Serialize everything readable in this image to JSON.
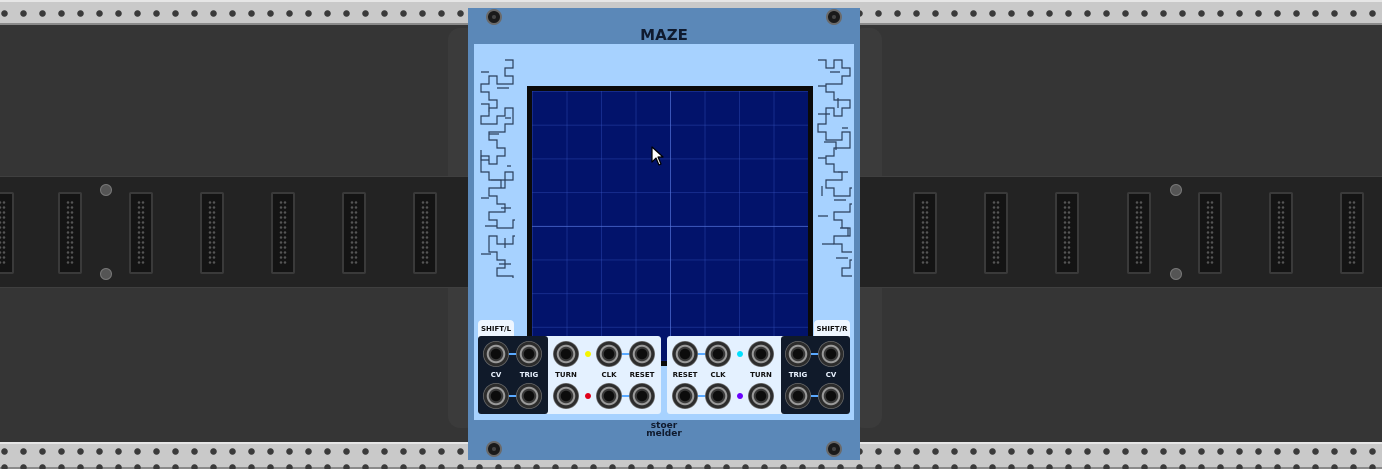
{
  "module": {
    "title": "MAZE",
    "brand_line1": "stoer",
    "brand_line2": "melder"
  },
  "shift": {
    "left_label": "SHIFT/L",
    "right_label": "SHIFT/R"
  },
  "left_panel": {
    "cv_label": "CV",
    "trig_label": "TRIG",
    "turn_label": "TURN",
    "clk_label": "CLK",
    "reset_label": "RESET",
    "led_top_color": "#f5f500",
    "led_bottom_color": "#e0001a"
  },
  "right_panel": {
    "reset_label": "RESET",
    "clk_label": "CLK",
    "turn_label": "TURN",
    "trig_label": "TRIG",
    "cv_label": "CV",
    "led_top_color": "#00e0ff",
    "led_bottom_color": "#6a00ff"
  },
  "colors": {
    "module_header": "#5b88b8",
    "module_body": "#a7d2ff",
    "screen": "#02136b"
  },
  "icons": {
    "cursor": "arrow-cursor-icon"
  }
}
